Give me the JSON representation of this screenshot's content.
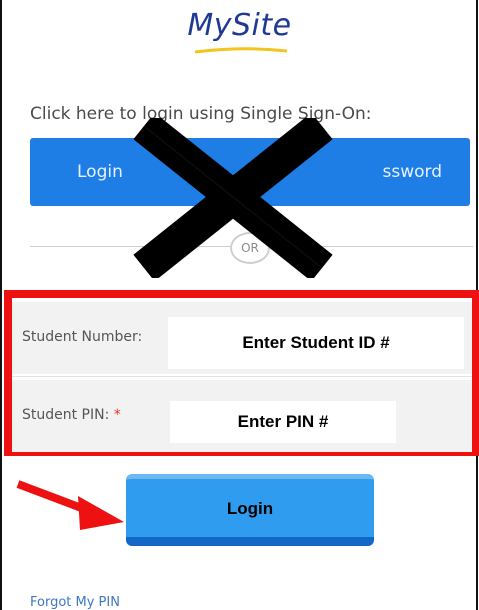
{
  "logo": {
    "text": "MySite"
  },
  "sso": {
    "prompt": "Click here to login using Single Sign-On:",
    "button_left": "Login",
    "button_right": "ssword",
    "divider_text": "OR"
  },
  "form": {
    "student_number_label": "Student Number:",
    "student_number_placeholder": "Enter Student ID #",
    "pin_label": "Student PIN:",
    "pin_required": "*",
    "pin_placeholder": "Enter PIN #"
  },
  "login_button": {
    "label": "Login"
  },
  "forgot_pin": {
    "label": "Forgot My PIN"
  },
  "colors": {
    "sso_blue": "#1f7ee6",
    "highlight_red": "#ee1111",
    "login_blue": "#2f9cf0",
    "cross": "#000000"
  }
}
